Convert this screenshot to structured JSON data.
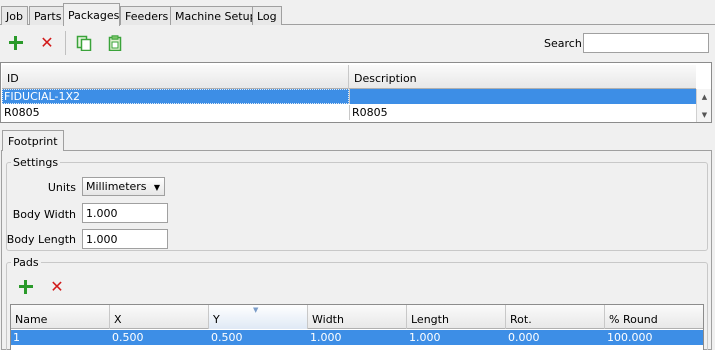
{
  "tabs": [
    "Job",
    "Parts",
    "Packages",
    "Feeders",
    "Machine Setup",
    "Log"
  ],
  "active_tab": "Packages",
  "toolbar": {
    "search_label": "Search",
    "search_value": "",
    "icons": [
      "plus-icon",
      "x-icon",
      "copy-icon",
      "paste-icon"
    ]
  },
  "packages": {
    "columns": [
      "ID",
      "Description"
    ],
    "rows": [
      {
        "id": "FIDUCIAL-1X2",
        "description": ""
      },
      {
        "id": "R0805",
        "description": "R0805"
      }
    ],
    "selected_row": 0
  },
  "footprint": {
    "tab_label": "Footprint",
    "settings": {
      "title": "Settings",
      "units_label": "Units",
      "units_value": "Millimeters",
      "body_width_label": "Body Width",
      "body_width_value": "1.000",
      "body_length_label": "Body Length",
      "body_length_value": "1.000"
    },
    "pads": {
      "title": "Pads",
      "columns": [
        "Name",
        "X",
        "Y",
        "Width",
        "Length",
        "Rot.",
        "% Round"
      ],
      "rows": [
        {
          "name": "1",
          "x": "0.500",
          "y": "0.500",
          "width": "1.000",
          "length": "1.000",
          "rot": "0.000",
          "round": "100.000"
        }
      ]
    }
  },
  "colors": {
    "selection": "#3d8ee6",
    "add_green": "#2a9a2a",
    "delete_red": "#d21a1a",
    "copy_green": "#3aa33a"
  }
}
